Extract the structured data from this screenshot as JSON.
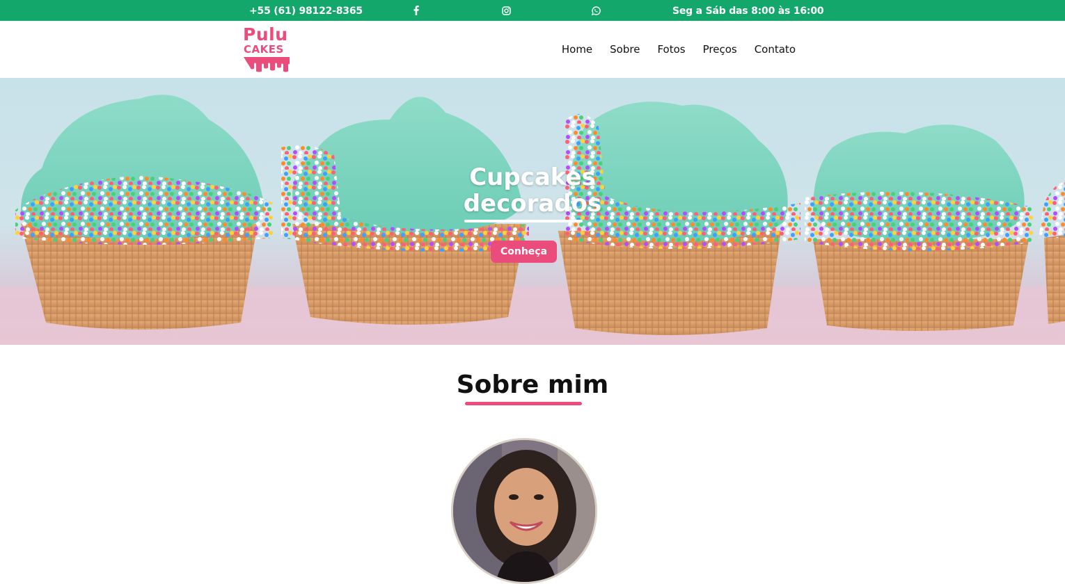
{
  "topbar": {
    "phone": "+55 (61) 98122-8365",
    "hours": "Seg a Sáb das 8:00 às 16:00",
    "social": [
      {
        "icon": "facebook-icon"
      },
      {
        "icon": "instagram-icon"
      },
      {
        "icon": "whatsapp-icon"
      }
    ],
    "bg_color": "#13a76c"
  },
  "header": {
    "logo_line1": "Pulu",
    "logo_line2": "CAKES",
    "nav": [
      {
        "label": "Home"
      },
      {
        "label": "Sobre"
      },
      {
        "label": "Fotos"
      },
      {
        "label": "Preços"
      },
      {
        "label": "Contato"
      }
    ]
  },
  "hero": {
    "title_line1": "Cupcakes",
    "title_line2": "decorados",
    "button": "Conheça",
    "accent_color": "#ea4c7c"
  },
  "about": {
    "title": "Sobre mim"
  }
}
